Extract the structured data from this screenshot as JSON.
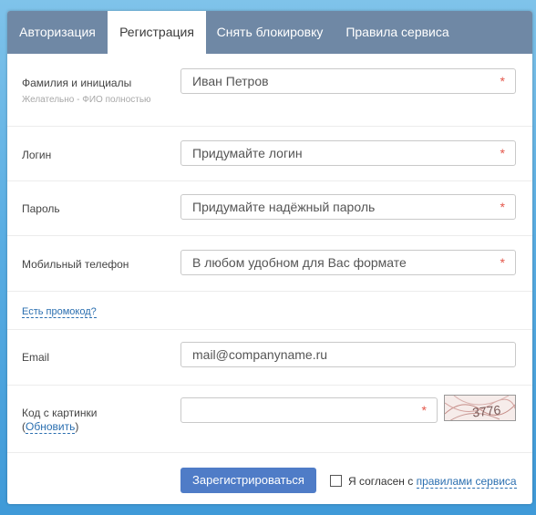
{
  "tabs": [
    {
      "label": "Авторизация"
    },
    {
      "label": "Регистрация"
    },
    {
      "label": "Снять блокировку"
    },
    {
      "label": "Правила сервиса"
    }
  ],
  "form": {
    "fullname": {
      "label": "Фамилия и инициалы",
      "hint": "Желательно - ФИО полностью",
      "value": "Иван Петров",
      "required_mark": "*"
    },
    "login": {
      "label": "Логин",
      "placeholder": "Придумайте логин",
      "required_mark": "*"
    },
    "password": {
      "label": "Пароль",
      "placeholder": "Придумайте надёжный пароль",
      "required_mark": "*"
    },
    "phone": {
      "label": "Мобильный телефон",
      "placeholder": "В любом удобном для Вас формате",
      "required_mark": "*"
    },
    "promo_link": "Есть промокод?",
    "email": {
      "label": "Email",
      "placeholder": "mail@companyname.ru"
    },
    "captcha": {
      "label": "Код с картинки",
      "paren_open": "(",
      "refresh_link": "Обновить",
      "paren_close": ")",
      "value": "",
      "required_mark": "*",
      "image_text": "3776"
    },
    "submit_label": "Зарегистрироваться",
    "agree_text": "Я согласен с",
    "agree_link": "правилами сервиса",
    "agree_checked": false
  },
  "colors": {
    "tab_bar": "#6f88a5",
    "button": "#4f7cc7",
    "link": "#2b6fb0",
    "required": "#e4574b"
  }
}
